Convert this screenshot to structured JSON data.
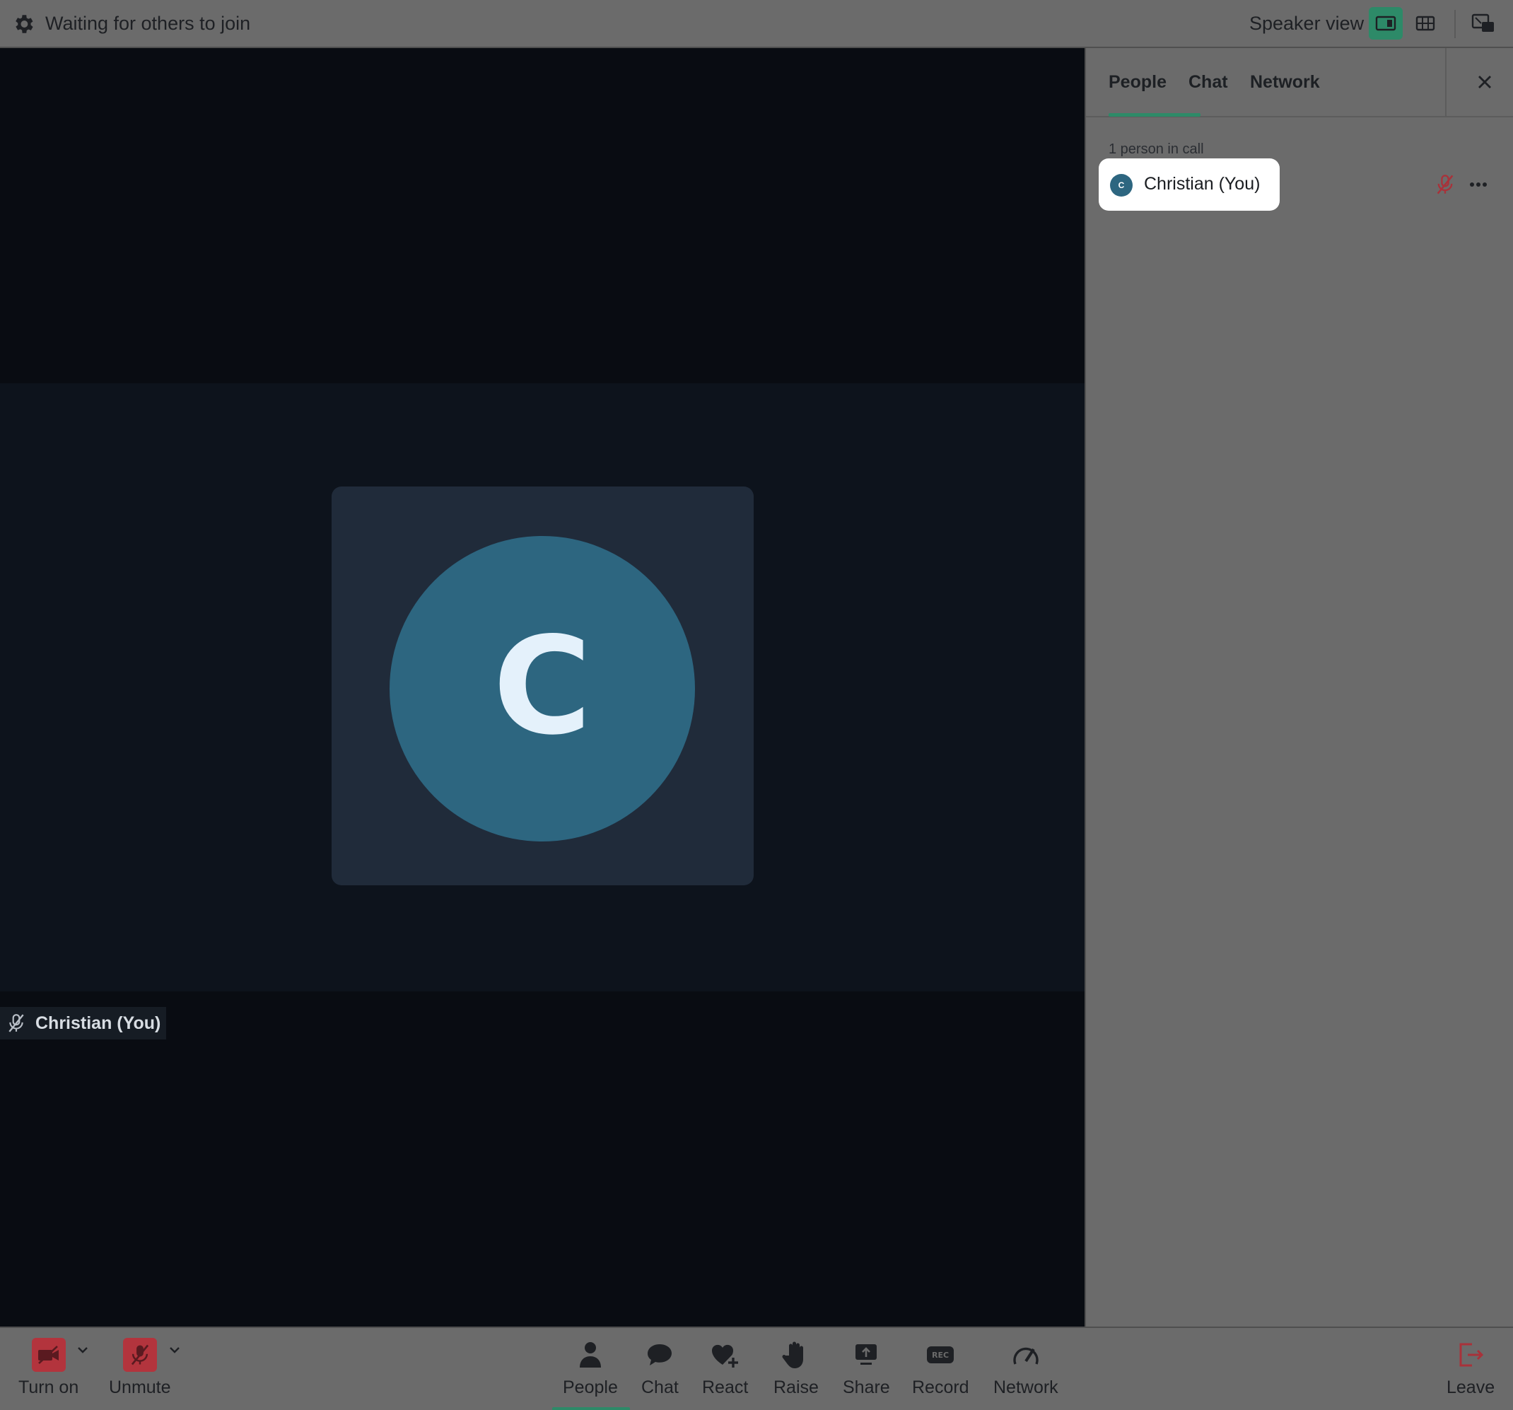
{
  "topbar": {
    "status": "Waiting for others to join",
    "view_label": "Speaker view"
  },
  "stage": {
    "avatar_letter": "C",
    "name_tag": "Christian (You)"
  },
  "panel": {
    "tabs": [
      {
        "label": "People",
        "active": true
      },
      {
        "label": "Chat",
        "active": false
      },
      {
        "label": "Network",
        "active": false
      }
    ],
    "count_label": "1 person in call",
    "people": [
      {
        "initial": "C",
        "name": "Christian (You)",
        "muted": true
      }
    ]
  },
  "controls": {
    "camera": "Turn on",
    "mic": "Unmute",
    "people": "People",
    "chat": "Chat",
    "react": "React",
    "raise": "Raise",
    "share": "Share",
    "record": "Record",
    "network": "Network",
    "leave": "Leave"
  },
  "colors": {
    "accent": "#2d8a68",
    "danger": "#b3343d",
    "avatar": "#2d6680",
    "chrome": "#6b6b6b"
  }
}
